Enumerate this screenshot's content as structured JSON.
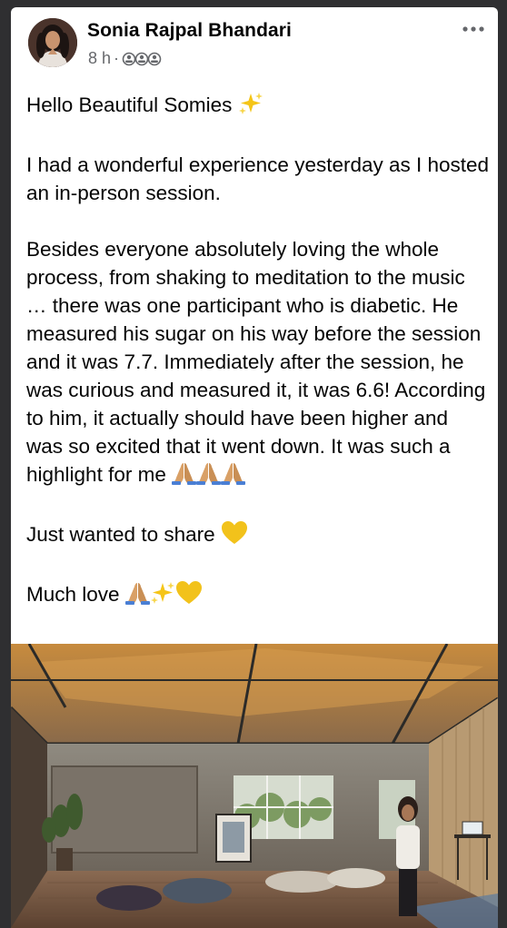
{
  "post": {
    "author": "Sonia Rajpal Bhandari",
    "time": "8 h",
    "separator": "·",
    "audience_icon": "friends-audience-icon",
    "more_icon": "more-options-icon",
    "paragraphs": [
      "Hello Beautiful Somies",
      "I had a wonderful experience yesterday as I hosted an in-person session.",
      "Besides everyone absolutely loving the whole process, from shaking to meditation to the music … there was one participant who is diabetic. He measured his sugar on his way before the session and it was 7.7. Immediately after the session, he was curious and measured it, it was 6.6! According to him, it actually should have been higher and was so excited that it went down. It was such a highlight for me",
      "Just wanted to share",
      "Much love"
    ],
    "photo": "post-photo"
  },
  "colors": {
    "background": "#2f2f31",
    "card": "#ffffff",
    "text": "#050505",
    "meta": "#65676b"
  }
}
